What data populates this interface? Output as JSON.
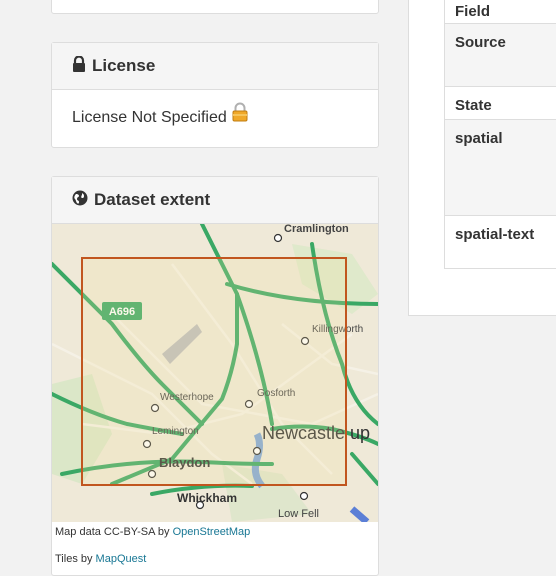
{
  "license": {
    "title": "License",
    "text": "License Not Specified",
    "icon": "lock-icon"
  },
  "extent": {
    "title": "Dataset extent",
    "icon": "globe-icon",
    "map_labels": {
      "road": "A696",
      "town1": "Cramlington",
      "town2": "Killingworth",
      "town3": "Westerhope",
      "town4": "Gosforth",
      "town5": "Lemington",
      "city": "Newcastle up",
      "town6": "Blaydon",
      "town7": "Whickham",
      "town8": "Low Fell"
    },
    "attribution_prefix": "Map data CC-BY-SA by ",
    "attribution_link": "OpenStreetMap",
    "tiles_prefix": "Tiles by ",
    "tiles_link": "MapQuest"
  },
  "table": {
    "rows": [
      {
        "label": "Field"
      },
      {
        "label": "Source"
      },
      {
        "label": "State"
      },
      {
        "label": "spatial"
      },
      {
        "label": "spatial-text"
      }
    ]
  },
  "colors": {
    "extent_box": "#c1561f",
    "road": "#3aa865",
    "link": "#187794"
  }
}
